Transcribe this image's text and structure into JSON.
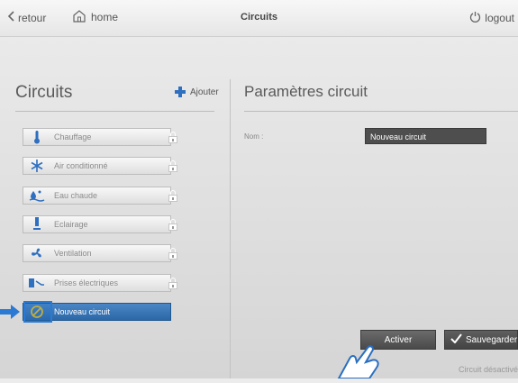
{
  "topbar": {
    "back_label": "retour",
    "home_label": "home",
    "title": "Circuits",
    "logout_label": "logout"
  },
  "left_panel": {
    "title": "Circuits",
    "add_label": "Ajouter",
    "items": [
      {
        "label": "Chauffage",
        "icon": "thermometer-icon"
      },
      {
        "label": "Air conditionné",
        "icon": "snowflake-icon"
      },
      {
        "label": "Eau chaude",
        "icon": "hot-water-icon"
      },
      {
        "label": "Eclairage",
        "icon": "lamp-icon"
      },
      {
        "label": "Ventilation",
        "icon": "fan-icon"
      },
      {
        "label": "Prises électriques",
        "icon": "plug-icon"
      }
    ],
    "active_item": {
      "label": "Nouveau circuit",
      "icon": "prohibited-icon"
    }
  },
  "right_panel": {
    "title": "Paramètres circuit",
    "name_label": "Nom :",
    "name_value": "Nouveau circuit",
    "activate_label": "Activer",
    "save_label": "Sauvegarder",
    "status": "Circuit désactivé"
  },
  "colors": {
    "accent": "#2f6fbf",
    "active_item": "#3a78b8",
    "dark_button": "#555555",
    "input_bg": "#4e4e4e"
  }
}
